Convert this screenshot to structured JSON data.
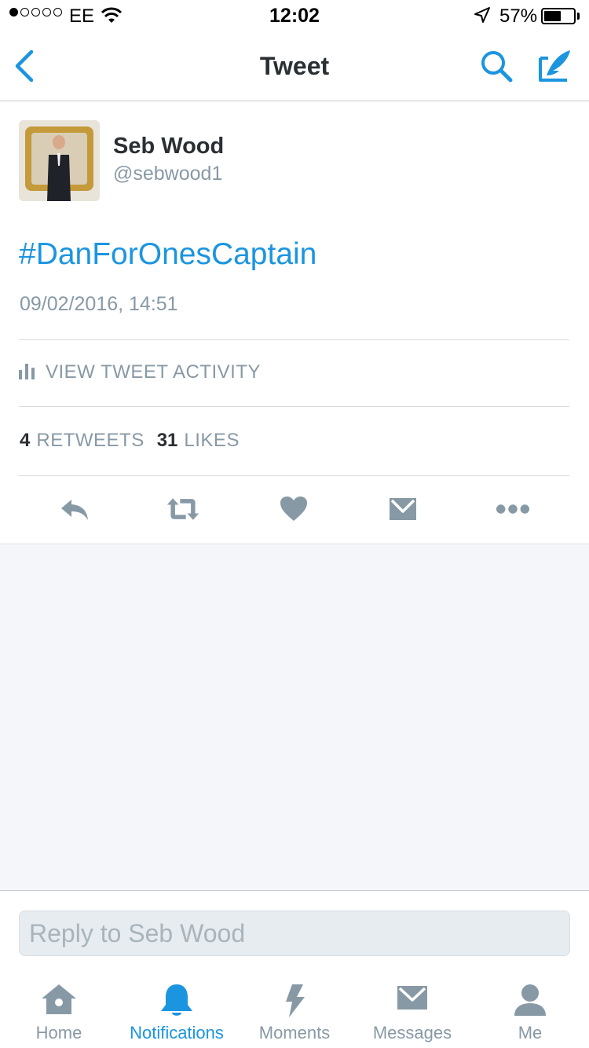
{
  "status_bar": {
    "carrier": "EE",
    "time": "12:02",
    "battery_percent_label": "57%",
    "battery_level": 0.57,
    "signal_bars_filled": 1,
    "signal_bars_total": 5
  },
  "nav": {
    "title": "Tweet",
    "back_icon": "chevron-left-icon",
    "search_icon": "search-icon",
    "compose_icon": "compose-quill-icon"
  },
  "tweet": {
    "author_name": "Seb Wood",
    "author_handle": "@sebwood1",
    "text": "#DanForOnesCaptain",
    "timestamp": "09/02/2016, 14:51",
    "activity_label": "VIEW TWEET ACTIVITY",
    "retweets_count": "4",
    "retweets_label": "RETWEETS",
    "likes_count": "31",
    "likes_label": "LIKES",
    "actions": [
      "reply-icon",
      "retweet-icon",
      "heart-icon",
      "direct-message-icon",
      "more-icon"
    ]
  },
  "reply": {
    "placeholder": "Reply to Seb Wood"
  },
  "tab_bar": {
    "tabs": [
      {
        "label": "Home",
        "icon": "home-icon"
      },
      {
        "label": "Notifications",
        "icon": "bell-icon"
      },
      {
        "label": "Moments",
        "icon": "lightning-icon"
      },
      {
        "label": "Messages",
        "icon": "envelope-icon"
      },
      {
        "label": "Me",
        "icon": "person-icon"
      }
    ],
    "active_index": 1
  },
  "colors": {
    "accent": "#1b95e0",
    "muted": "#8899a6",
    "icon_gray": "#8899a6",
    "text_dark": "#292f33",
    "empty_bg": "#f4f6f9"
  }
}
